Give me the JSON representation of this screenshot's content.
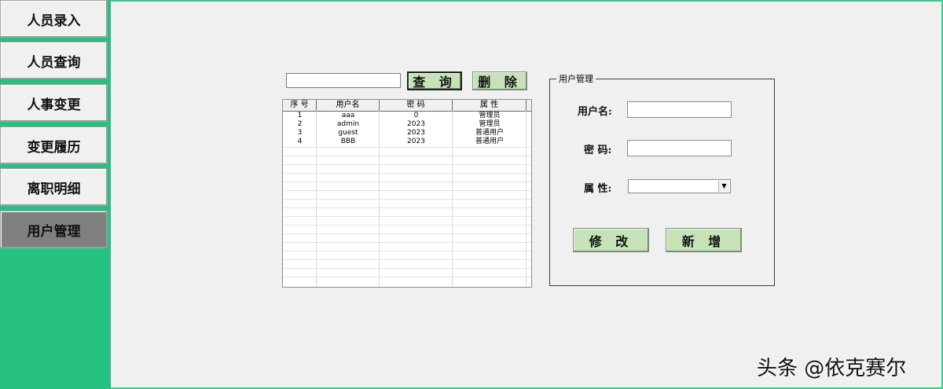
{
  "sidebar": {
    "items": [
      {
        "label": "人员录入",
        "active": false
      },
      {
        "label": "人员查询",
        "active": false
      },
      {
        "label": "人事变更",
        "active": false
      },
      {
        "label": "变更履历",
        "active": false
      },
      {
        "label": "离职明细",
        "active": false
      },
      {
        "label": "用户管理",
        "active": true
      }
    ]
  },
  "search": {
    "value": "",
    "query_label": "查 询",
    "delete_label": "删 除"
  },
  "table": {
    "columns": [
      "序 号",
      "用户名",
      "密 码",
      "属 性"
    ],
    "rows": [
      {
        "seq": "1",
        "username": "aaa",
        "password": "0",
        "attr": "管理员"
      },
      {
        "seq": "2",
        "username": "admin",
        "password": "2023",
        "attr": "管理员"
      },
      {
        "seq": "3",
        "username": "guest",
        "password": "2023",
        "attr": "普通用户"
      },
      {
        "seq": "4",
        "username": "BBB",
        "password": "2023",
        "attr": "普通用户"
      }
    ]
  },
  "user_panel": {
    "title": "用户管理",
    "username_label": "用户名:",
    "password_label": "密 码:",
    "attr_label": "属 性:",
    "username_value": "",
    "password_value": "",
    "attr_value": "",
    "modify_label": "修 改",
    "add_label": "新 增"
  },
  "watermark": "头条 @依克赛尔",
  "colors": {
    "sidebar_bg": "#26c080",
    "button_green": "#c6e3b8",
    "active_nav": "#808080",
    "panel_bg": "#f0f0f0"
  }
}
